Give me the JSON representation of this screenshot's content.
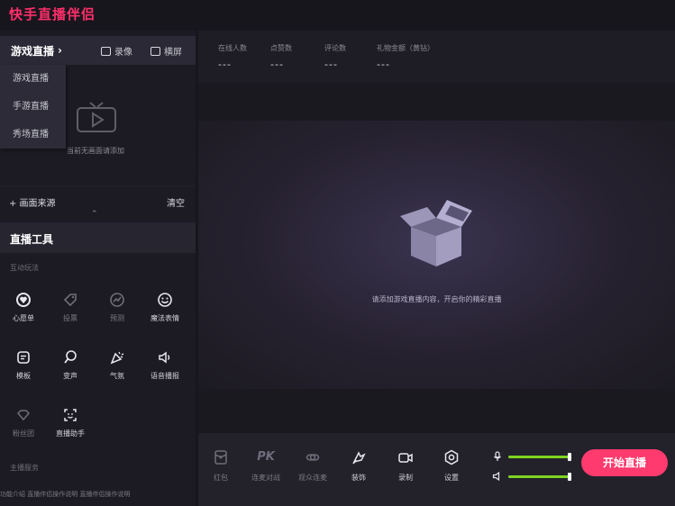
{
  "app": {
    "title": "快手直播伴侣"
  },
  "left_panel": {
    "scene_selector": {
      "label": "游戏直播",
      "chevron": "›"
    },
    "record_label": "录像",
    "landscape_label": "横屏",
    "dropdown_items": [
      "游戏直播",
      "手游直播",
      "秀场直播"
    ],
    "empty_hint": "当前无画面请添加",
    "add_source_label": "+ 画面来源",
    "clear_label": "清空",
    "collapse_caret": "⌃"
  },
  "tools": {
    "title": "直播工具",
    "interactive_section": "互动玩法",
    "items": [
      {
        "label": "心愿单",
        "icon": "heart-badge-icon"
      },
      {
        "label": "投票",
        "icon": "tag-icon"
      },
      {
        "label": "预测",
        "icon": "trend-icon"
      },
      {
        "label": "魔法表情",
        "icon": "smiley-icon"
      },
      {
        "label": "模板",
        "icon": "template-icon"
      },
      {
        "label": "变声",
        "icon": "voice-change-icon"
      },
      {
        "label": "气氛",
        "icon": "party-icon"
      },
      {
        "label": "语音播报",
        "icon": "speaker-icon"
      },
      {
        "label": "粉丝团",
        "icon": "fan-club-icon"
      },
      {
        "label": "直播助手",
        "icon": "assistant-icon"
      }
    ],
    "anchor_section": "主播服务",
    "bottom_strip": "功能介绍   直播伴侣操作说明   直播伴侣操作说明"
  },
  "stats": [
    {
      "label": "在线人数",
      "value": "---"
    },
    {
      "label": "点赞数",
      "value": "---"
    },
    {
      "label": "评论数",
      "value": "---"
    },
    {
      "label": "礼物金额（黄钻）",
      "value": "---"
    }
  ],
  "preview": {
    "hint": "请添加游戏直播内容，开启你的精彩直播"
  },
  "controls": {
    "items": [
      {
        "label": "红包",
        "icon": "red-packet-icon"
      },
      {
        "label": "连麦对战",
        "icon": "pk-icon",
        "text": "PK"
      },
      {
        "label": "观众连麦",
        "icon": "link-icon"
      },
      {
        "label": "装饰",
        "icon": "decorate-icon"
      },
      {
        "label": "录制",
        "icon": "camera-icon"
      },
      {
        "label": "设置",
        "icon": "settings-icon"
      }
    ],
    "mic_level": 1.0,
    "speaker_level": 1.0,
    "start_label": "开始直播"
  },
  "colors": {
    "brand": "#ff2f6a",
    "start_button": "#ff3a6e",
    "volume": "#7ed321"
  }
}
